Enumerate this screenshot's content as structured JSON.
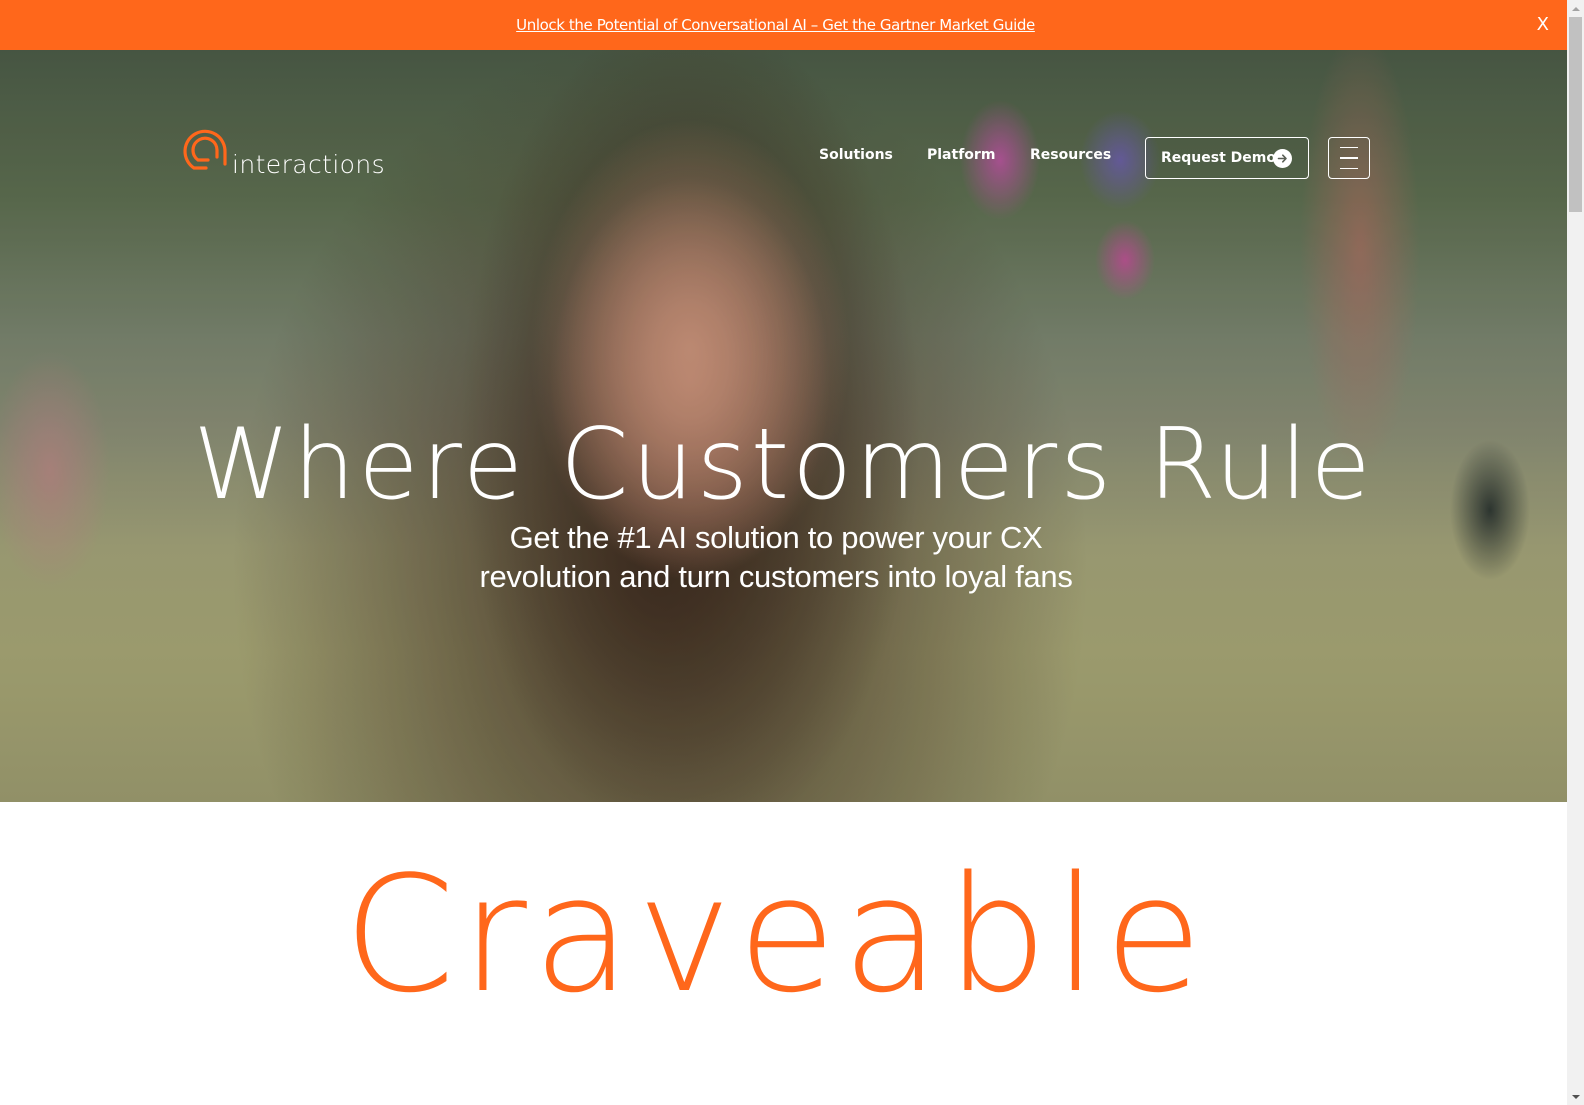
{
  "announcement": {
    "link_text": "Unlock the Potential of Conversational AI – Get the Gartner Market Guide",
    "close_label": "X"
  },
  "brand": {
    "name": "interactions",
    "accent_color": "#ff671b",
    "logo_icon": "at-sign-speech-bubble-icon"
  },
  "nav": {
    "items": [
      {
        "label": "Solutions"
      },
      {
        "label": "Platform"
      },
      {
        "label": "Resources"
      }
    ],
    "cta_label": "Request Demo",
    "cta_icon": "arrow-right-circle-icon",
    "menu_icon": "hamburger-menu-icon"
  },
  "hero": {
    "title": "Where Customers Rule",
    "subtitle_line1": "Get the #1 AI solution to power your CX",
    "subtitle_line2": "revolution and turn customers into loyal fans",
    "background": "video of smiling woman with curly hair at outdoor festival"
  },
  "section": {
    "heading": "Craveable"
  }
}
